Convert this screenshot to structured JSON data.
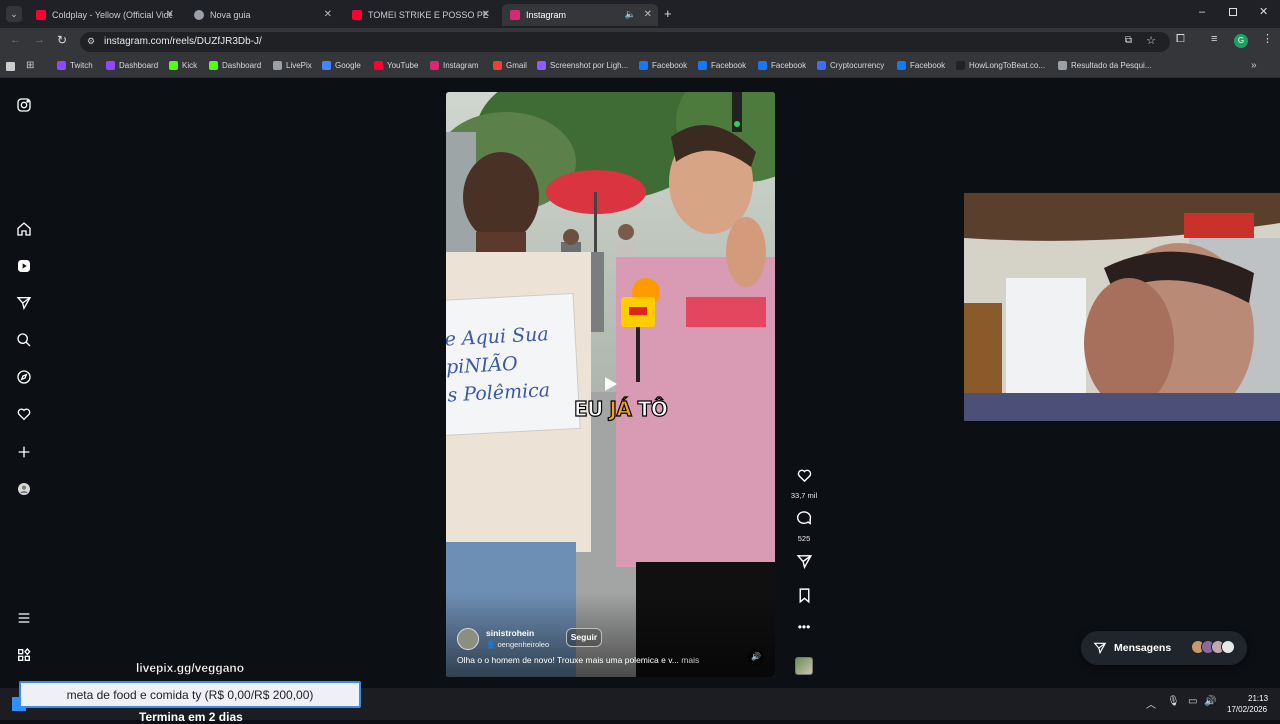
{
  "tabs": [
    {
      "title": "Coldplay - Yellow (Official Video)",
      "color": "#ff0033"
    },
    {
      "title": "Nova guia",
      "color": "#9aa0a6"
    },
    {
      "title": "TOMEI STRIKE E POSSO PERDER O CANAL",
      "color": "#ff0033"
    },
    {
      "title": "Instagram",
      "color": "#d62976"
    }
  ],
  "address": {
    "url": "instagram.com/reels/DUZfJR3Db-J/"
  },
  "bookmarks": [
    {
      "label": "Twitch",
      "color": "#9146ff"
    },
    {
      "label": "Dashboard",
      "color": "#9146ff"
    },
    {
      "label": "Kick",
      "color": "#53fc18"
    },
    {
      "label": "Dashboard",
      "color": "#53fc18"
    },
    {
      "label": "LivePix",
      "color": "#9aa0a6"
    },
    {
      "label": "Google",
      "color": "#4285f4"
    },
    {
      "label": "YouTube",
      "color": "#ff0033"
    },
    {
      "label": "Instagram",
      "color": "#d62976"
    },
    {
      "label": "Gmail",
      "color": "#ea4335"
    },
    {
      "label": "Screenshot por Ligh...",
      "color": "#8e5cff"
    },
    {
      "label": "Facebook",
      "color": "#1877f2"
    },
    {
      "label": "Facebook",
      "color": "#1877f2"
    },
    {
      "label": "Facebook",
      "color": "#1877f2"
    },
    {
      "label": "Cryptocurrency",
      "color": "#3c6ff5"
    },
    {
      "label": "Facebook",
      "color": "#1877f2"
    },
    {
      "label": "HowLongToBeat.co...",
      "color": "#222222"
    },
    {
      "label": "Resultado da Pesqui...",
      "color": "#9aa0a6"
    }
  ],
  "sidebar": {
    "icons": [
      "instagram-logo-icon",
      "home-icon",
      "reels-icon",
      "direct-icon",
      "search-icon",
      "explore-icon",
      "heart-icon",
      "create-icon",
      "profile-icon",
      "menu-icon",
      "apps-icon"
    ]
  },
  "reel": {
    "caption_overlay_a": "EU ",
    "caption_overlay_b": "JÁ",
    "caption_overlay_c": " TÔ",
    "sign_text": "e Aqui Sua\npiNIÃO\ns Polêmica",
    "username": "sinistrohein",
    "collab": "oengenheiroleo",
    "follow_label": "Seguir",
    "description": "Olha o o homem de novo! Trouxe mais uma polemica e v...",
    "more_label": "mais"
  },
  "actions": {
    "likes": "33,7 mil",
    "comments": "525"
  },
  "messages": {
    "label": "Mensagens"
  },
  "overlays": {
    "livepix": "livepix.gg/veggano",
    "goal": "meta de food e comida ty (R$ 0,00/R$ 200,00)",
    "ends": "Termina em 2 dias"
  },
  "taskbar": {
    "time": "21:13",
    "date": "17/02/2026"
  },
  "colors": {
    "accent_red": "#e0242b",
    "follow_bg": "#262a30",
    "instagram": "#d62976"
  }
}
